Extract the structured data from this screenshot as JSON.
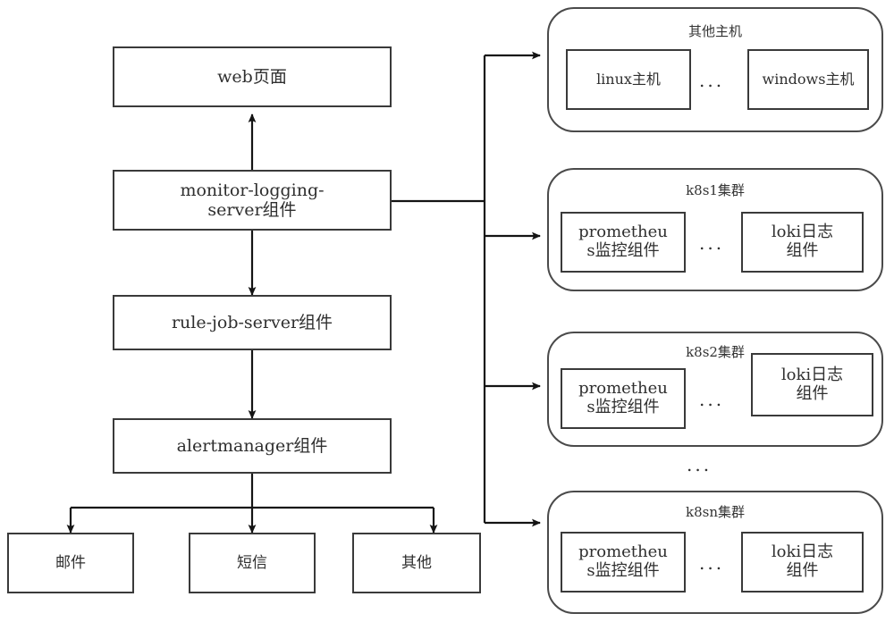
{
  "diagram": {
    "title": "monitoring and logging platform architecture",
    "stroke_color": "#3a3a3a",
    "background": "#ffffff"
  },
  "left_column": {
    "nodes": [
      {
        "id": "web",
        "label": "web页面"
      },
      {
        "id": "monitor_logging_server",
        "label": "monitor-logging-\nserver组件"
      },
      {
        "id": "rule_job_server",
        "label": "rule-job-server组件"
      },
      {
        "id": "alertmanager",
        "label": "alertmanager组件"
      }
    ],
    "outputs": [
      {
        "id": "email",
        "label": "邮件"
      },
      {
        "id": "sms",
        "label": "短信"
      },
      {
        "id": "other",
        "label": "其他"
      }
    ]
  },
  "right_column": {
    "groups": [
      {
        "id": "other_hosts",
        "title": "其他主机",
        "items": [
          {
            "id": "linux_host",
            "label": "linux主机"
          },
          {
            "id": "windows_host",
            "label": "windows主机"
          }
        ],
        "separator": "..."
      },
      {
        "id": "k8s1",
        "title": "k8s1集群",
        "items": [
          {
            "id": "prometheus_1",
            "label": "prometheu\ns监控组件"
          },
          {
            "id": "loki_1",
            "label": "loki日志\n组件"
          }
        ],
        "separator": "..."
      },
      {
        "id": "k8s2",
        "title": "k8s2集群",
        "items": [
          {
            "id": "prometheus_2",
            "label": "prometheu\ns监控组件"
          },
          {
            "id": "loki_2",
            "label": "loki日志\n组件"
          }
        ],
        "separator": "..."
      },
      {
        "id": "k8sn",
        "title": "k8sn集群",
        "items": [
          {
            "id": "prometheus_n",
            "label": "prometheu\ns监控组件"
          },
          {
            "id": "loki_n",
            "label": "loki日志\n组件"
          }
        ],
        "separator": "..."
      }
    ],
    "group_separator": "..."
  }
}
